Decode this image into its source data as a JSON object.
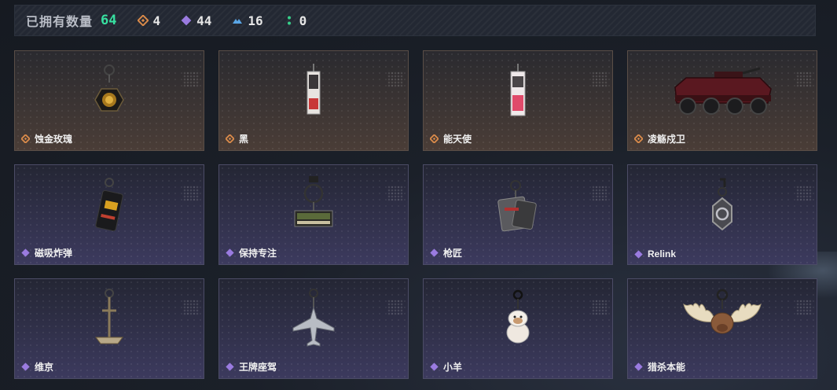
{
  "header": {
    "owned_label": "已拥有数量",
    "owned_count": "64",
    "stats": [
      {
        "icon": "gold-rarity-icon",
        "color": "#d98a4a",
        "value": "4"
      },
      {
        "icon": "purple-rarity-icon",
        "color": "#9a7be0",
        "value": "44"
      },
      {
        "icon": "blue-rarity-icon",
        "color": "#5aa6e6",
        "value": "16"
      },
      {
        "icon": "green-rarity-icon",
        "color": "#37d08a",
        "value": "0"
      }
    ]
  },
  "colors": {
    "gold": "#d98a4a",
    "purple": "#9a7be0",
    "accent": "#37e0a0"
  },
  "items": [
    {
      "name": "蚀金玫瑰",
      "rarity": "gold",
      "icon": "golden-rose-charm-icon"
    },
    {
      "name": "黑",
      "rarity": "gold",
      "icon": "black-tag-charm-icon"
    },
    {
      "name": "能天使",
      "rarity": "gold",
      "icon": "exusiai-tag-charm-icon"
    },
    {
      "name": "凌觞戍卫",
      "rarity": "gold",
      "icon": "armored-vehicle-icon"
    },
    {
      "name": "磁吸炸弹",
      "rarity": "purple",
      "icon": "magnetic-bomb-charm-icon"
    },
    {
      "name": "保持专注",
      "rarity": "purple",
      "icon": "stay-focused-charm-icon"
    },
    {
      "name": "枪匠",
      "rarity": "purple",
      "icon": "gunsmith-tag-charm-icon"
    },
    {
      "name": "Relink",
      "rarity": "purple",
      "icon": "relink-charm-icon"
    },
    {
      "name": "维京",
      "rarity": "purple",
      "icon": "viking-anchor-charm-icon"
    },
    {
      "name": "王牌座驾",
      "rarity": "purple",
      "icon": "fighter-jet-charm-icon"
    },
    {
      "name": "小羊",
      "rarity": "purple",
      "icon": "little-sheep-charm-icon"
    },
    {
      "name": "猎杀本能",
      "rarity": "purple",
      "icon": "moose-antler-charm-icon"
    }
  ]
}
